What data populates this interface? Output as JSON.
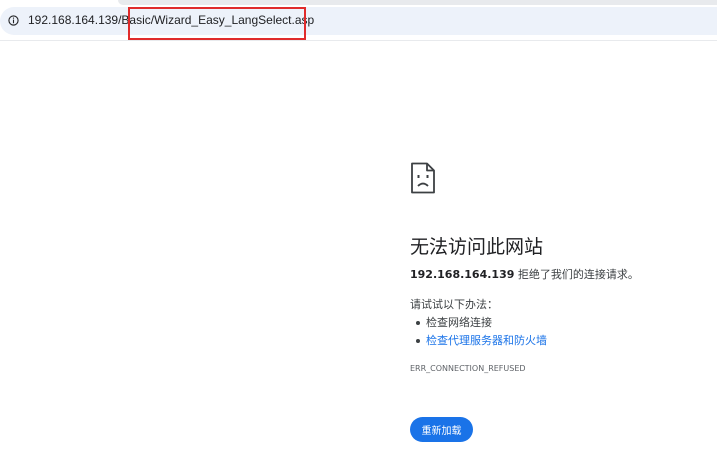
{
  "address_bar": {
    "url": "192.168.164.139/Basic/Wizard_Easy_LangSelect.asp",
    "info_icon": "info-circle-icon"
  },
  "annotation": {
    "color": "#e02b2b"
  },
  "error_page": {
    "icon": "sad-document-icon",
    "title": "无法访问此网站",
    "host": "192.168.164.139",
    "message": " 拒绝了我们的连接请求。",
    "try_label": "请试试以下办法：",
    "suggestions": [
      {
        "label": "检查网络连接",
        "is_link": false
      },
      {
        "label": "检查代理服务器和防火墙",
        "is_link": true
      }
    ],
    "error_code": "ERR_CONNECTION_REFUSED",
    "reload_label": "重新加载"
  },
  "colors": {
    "accent": "#1a73e8",
    "address_bar_bg": "#edf2fa",
    "text": "#202124"
  }
}
